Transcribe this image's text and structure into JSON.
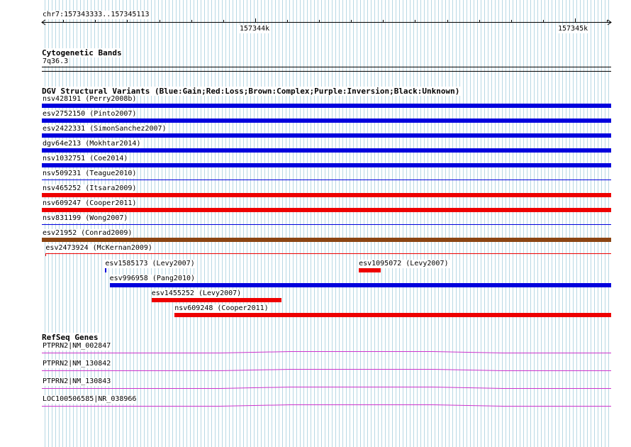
{
  "ruler": {
    "range_label": "chr7:157343333..157345113",
    "major_labels": [
      "157344k",
      "157345k"
    ]
  },
  "cytoband": {
    "title": "Cytogenetic Bands",
    "band": "7q36.3"
  },
  "dgv": {
    "title": "DGV Structural Variants (Blue:Gain;Red:Loss;Brown:Complex;Purple:Inversion;Black:Unknown)",
    "colors": {
      "gain": "#0000dd",
      "loss": "#ee0000",
      "complex": "#8b4513",
      "none": "#ee0000"
    },
    "variants": [
      {
        "label": "nsv428191 (Perry2008b)",
        "type": "gain",
        "start": 157343333,
        "end": 157345113
      },
      {
        "label": "esv2752150 (Pinto2007)",
        "type": "gain",
        "start": 157343333,
        "end": 157345113
      },
      {
        "label": "esv2422331 (SimonSanchez2007)",
        "type": "gain",
        "start": 157343333,
        "end": 157345113
      },
      {
        "label": "dgv64e213 (Mokhtar2014)",
        "type": "gain",
        "start": 157343333,
        "end": 157345113
      },
      {
        "label": "nsv1032751 (Coe2014)",
        "type": "gain",
        "start": 157343333,
        "end": 157345113
      },
      {
        "label": "nsv509231 (Teague2010)",
        "type": "none",
        "start": 157343333,
        "end": 157345113
      },
      {
        "label": "nsv465252 (Itsara2009)",
        "type": "loss",
        "start": 157343333,
        "end": 157345113
      },
      {
        "label": "nsv609247 (Cooper2011)",
        "type": "loss",
        "start": 157343333,
        "end": 157345113
      },
      {
        "label": "nsv831199 (Wong2007)",
        "type": "none",
        "start": 157343333,
        "end": 157345113
      },
      {
        "label": "esv21952 (Conrad2009)",
        "type": "complex",
        "start": 157343333,
        "end": 157345113
      },
      {
        "label": "esv2473924 (McKernan2009)",
        "type": "loss",
        "start": 157343345,
        "end": 157345113,
        "thin": true
      },
      {
        "label": "esv1585173 (Levy2007)",
        "type": "gain",
        "start": 157343531,
        "end": 157343533
      },
      {
        "label": "esv1095072 (Levy2007)",
        "type": "loss",
        "start": 157344324,
        "end": 157344393
      },
      {
        "label": "esv996958 (Pang2010)",
        "type": "gain",
        "start": 157343545,
        "end": 157345113
      },
      {
        "label": "esv1455252 (Levy2007)",
        "type": "loss",
        "start": 157343676,
        "end": 157344083
      },
      {
        "label": "nsv609248 (Cooper2011)",
        "type": "loss",
        "start": 157343748,
        "end": 157345113
      }
    ]
  },
  "refseq": {
    "title": "RefSeq Genes",
    "color": "#cc33cc",
    "genes": [
      {
        "label": "PTPRN2|NM_002847"
      },
      {
        "label": "PTPRN2|NM_130842"
      },
      {
        "label": "PTPRN2|NM_130843"
      },
      {
        "label": "LOC100506585|NR_038966"
      }
    ]
  }
}
